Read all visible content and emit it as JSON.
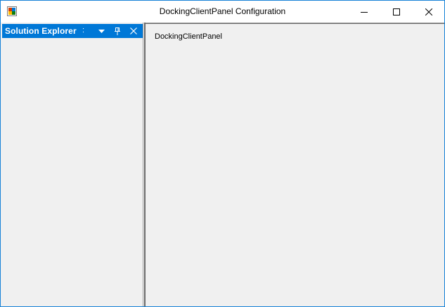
{
  "window": {
    "title": "DockingClientPanel Configuration"
  },
  "dock_panel": {
    "title": "Solution Explorer",
    "dots": ":"
  },
  "client_panel": {
    "label": "DockingClientPanel"
  },
  "colors": {
    "accent": "#0078d7",
    "window_border": "#1883d7",
    "surface": "#f0f0f0"
  },
  "icons": [
    "app-icon",
    "minimize-icon",
    "maximize-icon",
    "close-icon",
    "dropdown-arrow-icon",
    "pin-icon",
    "close-panel-icon"
  ]
}
